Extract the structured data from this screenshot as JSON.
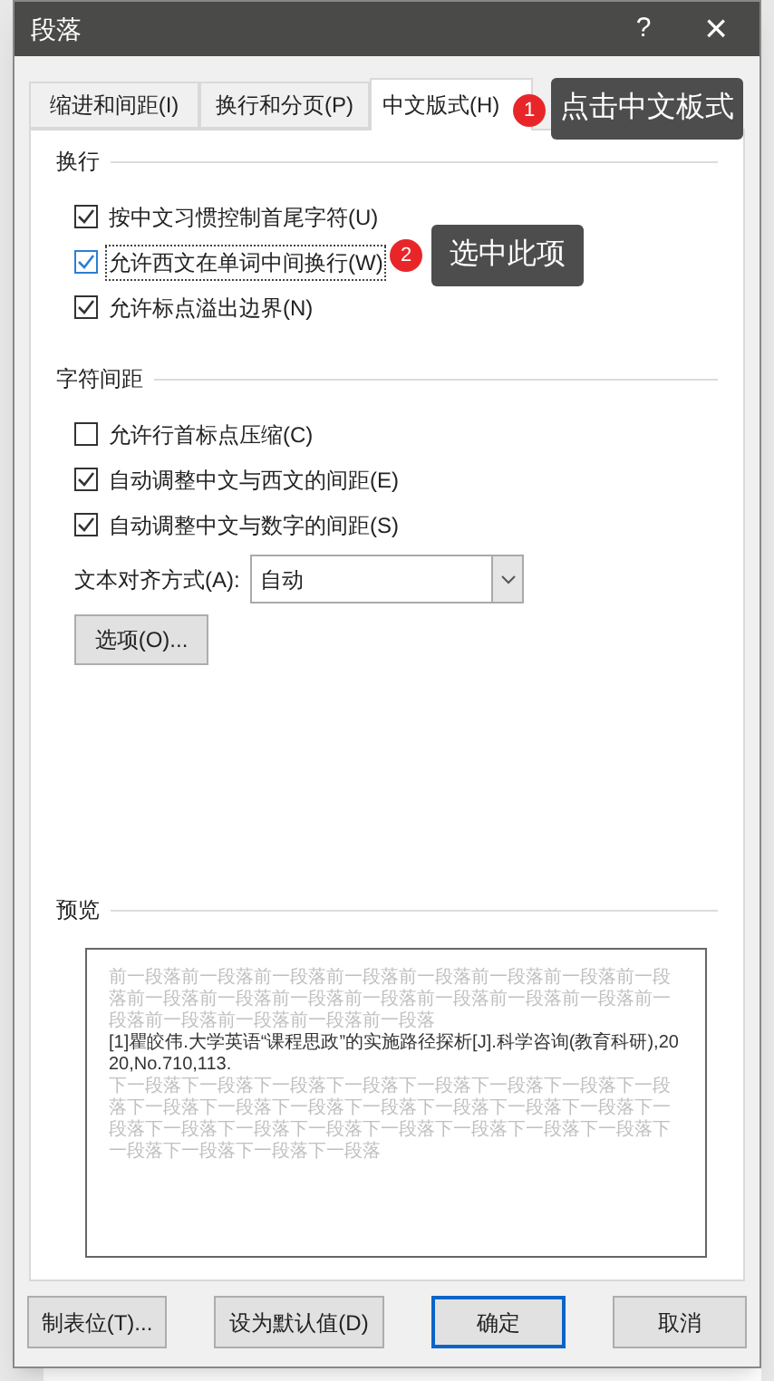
{
  "window": {
    "title": "段落",
    "help": "?",
    "close": "×"
  },
  "tabs": [
    {
      "label": "缩进和间距(I)",
      "selected": false
    },
    {
      "label": "换行和分页(P)",
      "selected": false
    },
    {
      "label": "中文版式(H)",
      "selected": true
    }
  ],
  "sections": [
    {
      "title": "换行",
      "options": [
        {
          "label": "按中文习惯控制首尾字符(U)",
          "checked": true,
          "focused": false
        },
        {
          "label": "允许西文在单词中间换行(W)",
          "checked": true,
          "focused": true
        },
        {
          "label": "允许标点溢出边界(N)",
          "checked": true,
          "focused": false
        }
      ]
    },
    {
      "title": "字符间距",
      "options": [
        {
          "label": "允许行首标点压缩(C)",
          "checked": false,
          "focused": false
        },
        {
          "label": "自动调整中文与西文的间距(E)",
          "checked": true,
          "focused": false
        },
        {
          "label": "自动调整中文与数字的间距(S)",
          "checked": true,
          "focused": false
        }
      ],
      "alignment": {
        "label": "文本对齐方式(A):",
        "value": "自动"
      },
      "button": "选项(O)..."
    }
  ],
  "preview": {
    "title": "预览",
    "previous": "前一段落前一段落前一段落前一段落前一段落前一段落前一段落前一段落前一段落前一段落前一段落前一段落前一段落前一段落前一段落前一段落前一段落前一段落前一段落前一段落",
    "sample": "[1]瞿皎伟.大学英语“课程思政”的实施路径探析[J].科学咨询(教育科研),2020,No.710,113.",
    "next": "下一段落下一段落下一段落下一段落下一段落下一段落下一段落下一段落下一段落下一段落下一段落下一段落下一段落下一段落下一段落下一段落下一段落下一段落下一段落下一段落下一段落下一段落下一段落下一段落下一段落下一段落下一段落"
  },
  "buttons": [
    {
      "label": "制表位(T)...",
      "default": false
    },
    {
      "label": "设为默认值(D)",
      "default": false
    },
    {
      "label": "确定",
      "default": true
    },
    {
      "label": "取消",
      "default": false
    }
  ],
  "annotations": [
    {
      "number": "1",
      "text": "点击中文板式"
    },
    {
      "number": "2",
      "text": "选中此项"
    }
  ]
}
